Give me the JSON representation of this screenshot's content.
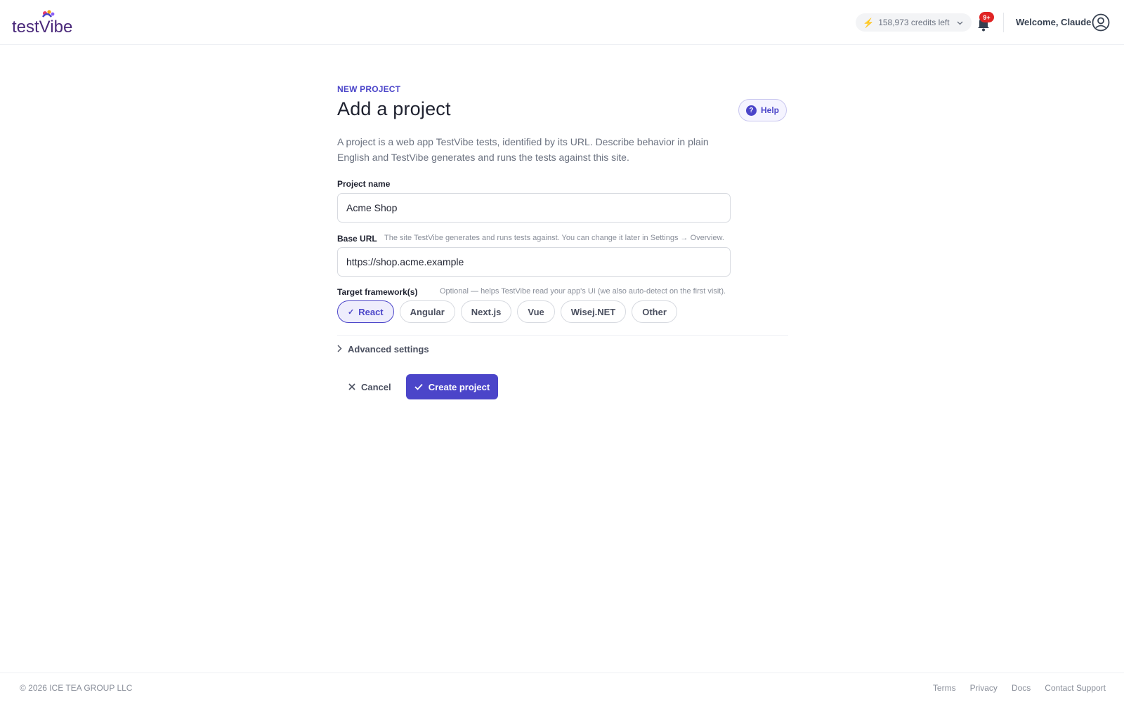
{
  "header": {
    "logo_text": "testVibe",
    "credits_label": "158,973 credits left",
    "notification_badge": "9+",
    "welcome_text": "Welcome, Claude"
  },
  "form": {
    "eyebrow": "NEW PROJECT",
    "title": "Add a project",
    "help_label": "Help",
    "description": "A project is a web app TestVibe tests, identified by its URL. Describe behavior in plain English and TestVibe generates and runs the tests against this site.",
    "project_name": {
      "label": "Project name",
      "value": "Acme Shop"
    },
    "base_url": {
      "label": "Base URL",
      "hint": "The site TestVibe generates and runs tests against. You can change it later in Settings → Overview.",
      "value": "https://shop.acme.example"
    },
    "frameworks": {
      "label": "Target framework(s)",
      "hint": "Optional — helps TestVibe read your app's UI (we also auto-detect on the first visit).",
      "options": [
        {
          "label": "React",
          "selected": true
        },
        {
          "label": "Angular",
          "selected": false
        },
        {
          "label": "Next.js",
          "selected": false
        },
        {
          "label": "Vue",
          "selected": false
        },
        {
          "label": "Wisej.NET",
          "selected": false
        },
        {
          "label": "Other",
          "selected": false
        }
      ]
    },
    "advanced_label": "Advanced settings",
    "cancel_label": "Cancel",
    "create_label": "Create project"
  },
  "footer": {
    "copyright": "© 2026 ICE TEA GROUP LLC",
    "links": [
      "Terms",
      "Privacy",
      "Docs",
      "Contact Support"
    ]
  },
  "colors": {
    "accent": "#4b45c9",
    "badge": "#e02424"
  }
}
